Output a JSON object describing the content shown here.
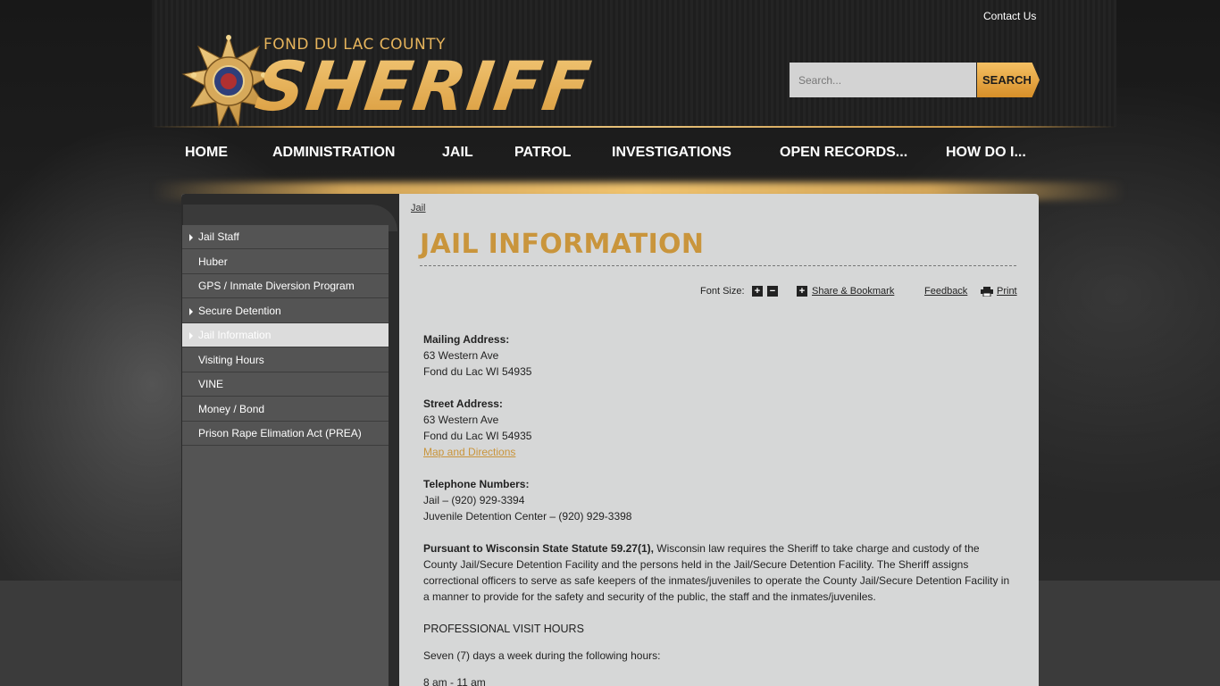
{
  "header": {
    "logo_county": "FOND DU LAC COUNTY",
    "logo_sheriff": "SHERIFF",
    "contact_link": "Contact Us",
    "search_placeholder": "Search...",
    "search_button": "SEARCH"
  },
  "nav": [
    "HOME",
    "ADMINISTRATION",
    "JAIL",
    "PATROL",
    "INVESTIGATIONS",
    "OPEN RECORDS...",
    "HOW DO I..."
  ],
  "sidebar": {
    "items": [
      {
        "label": "Jail Staff",
        "arrow": true,
        "active": false
      },
      {
        "label": "Huber",
        "arrow": false,
        "active": false
      },
      {
        "label": "GPS / Inmate Diversion Program",
        "arrow": false,
        "active": false
      },
      {
        "label": "Secure Detention",
        "arrow": true,
        "active": false
      },
      {
        "label": "Jail Information",
        "arrow": true,
        "active": true
      },
      {
        "label": "Visiting Hours",
        "arrow": false,
        "active": false
      },
      {
        "label": "VINE",
        "arrow": false,
        "active": false
      },
      {
        "label": "Money / Bond",
        "arrow": false,
        "active": false
      },
      {
        "label": "Prison Rape Elimation Act (PREA)",
        "arrow": false,
        "active": false
      }
    ]
  },
  "breadcrumb": "Jail",
  "page_title": "JAIL INFORMATION",
  "tools": {
    "font_size": "Font Size:",
    "share": "Share & Bookmark",
    "feedback": "Feedback",
    "print": "Print"
  },
  "content": {
    "mailing_heading": "Mailing Address:",
    "mailing_line1": "63 Western Ave",
    "mailing_line2": "Fond du Lac WI 54935",
    "street_heading": "Street Address:",
    "street_line1": "63 Western Ave",
    "street_line2": "Fond du Lac WI 54935",
    "map_link": "Map and Directions",
    "phone_heading": "Telephone Numbers:",
    "phone_jail": "Jail – (920) 929-3394",
    "phone_juvenile": "Juvenile Detention Center – (920) 929-3398",
    "statute_bold": "Pursuant to Wisconsin State Statute 59.27(1),",
    "statute_text": " Wisconsin law requires the Sheriff to take charge and custody of the County Jail/Secure Detention Facility and the persons held in the Jail/Secure Detention Facility. The Sheriff assigns correctional officers to serve as safe keepers of the inmates/juveniles to operate the County Jail/Secure Detention Facility in a manner to provide for the safety and security of the public, the staff and the inmates/juveniles.",
    "visit_heading": "PROFESSIONAL VISIT HOURS",
    "visit_days": "Seven (7) days a week during the following hours:",
    "visit_hours": "8 am - 11 am"
  },
  "colors": {
    "gold": "#c9953c",
    "panel": "#d6d7d7",
    "sidebar": "#545454"
  }
}
